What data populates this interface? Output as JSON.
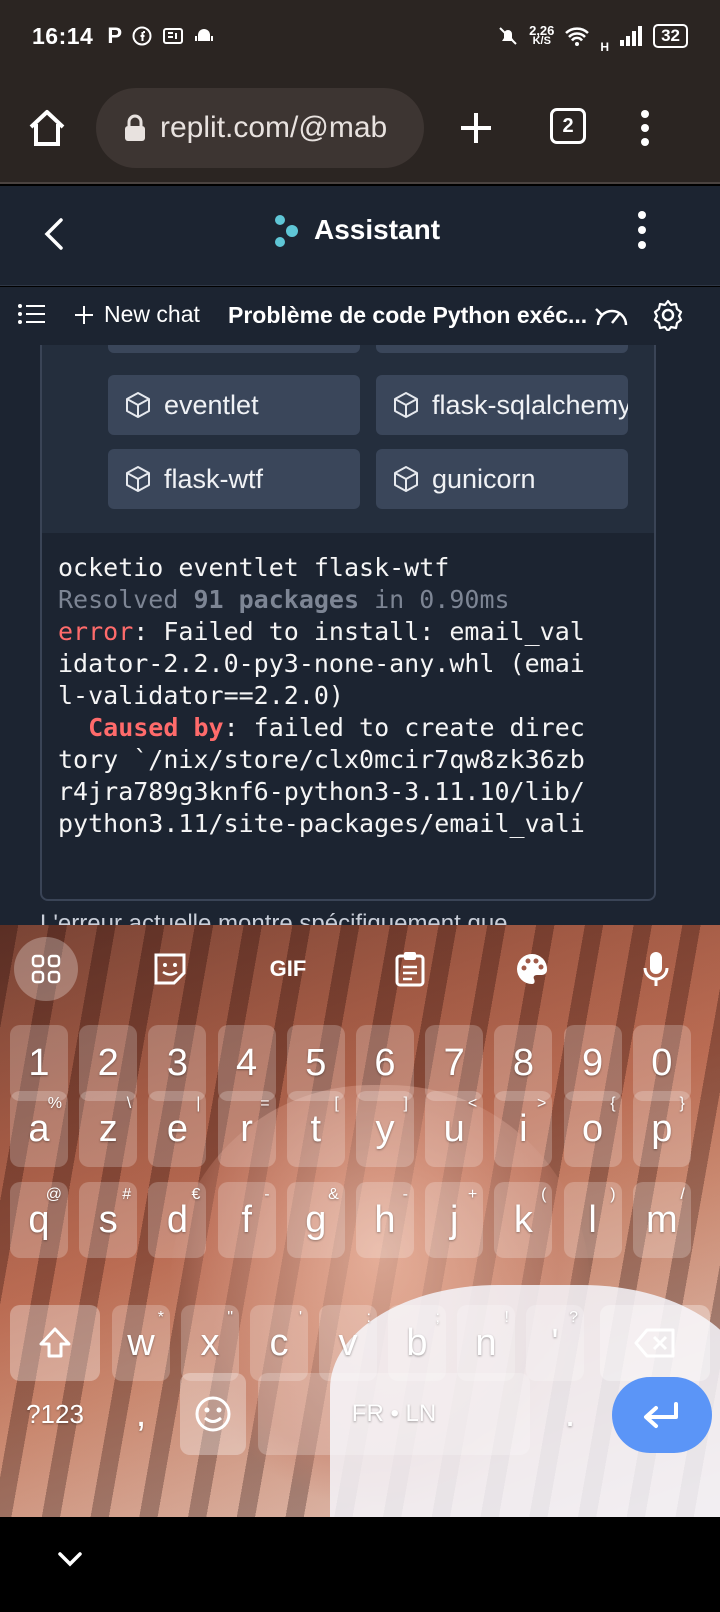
{
  "status_bar": {
    "time": "16:14",
    "net_speed_value": "2,26",
    "net_speed_unit": "K/S",
    "signal_label": "H",
    "battery": "32"
  },
  "browser": {
    "url": "replit.com/@mab",
    "tab_count": "2"
  },
  "app_header": {
    "title": "Assistant"
  },
  "toolbar": {
    "new_chat_label": "New chat",
    "chat_title": "Problème de code Python exéc..."
  },
  "packages": [
    "eventlet",
    "flask-sqlalchemy",
    "flask-wtf",
    "gunicorn"
  ],
  "terminal": {
    "line1": "ocketio eventlet flask-wtf",
    "resolved_prefix": "Resolved ",
    "resolved_count": "91 packages",
    "resolved_suffix": " in 0.90ms",
    "error_label": "error",
    "error_msg_1": ": Failed to install: email_val",
    "error_msg_2": "idator-2.2.0-py3-none-any.whl (emai",
    "error_msg_3": "l-validator==2.2.0)",
    "caused_by_label": "  Caused by",
    "caused_msg_1": ": failed to create direc",
    "caused_msg_2": "tory `/nix/store/clx0mcir7qw8zk36zb",
    "caused_msg_3": "r4jra789g3knf6-python3-3.11.10/lib/",
    "caused_msg_4": "python3.11/site-packages/email_vali"
  },
  "peek_text": "L'erreur actuelle montre spécifiquement que",
  "keyboard": {
    "toolbar_gif": "GIF",
    "number_row": [
      "1",
      "2",
      "3",
      "4",
      "5",
      "6",
      "7",
      "8",
      "9",
      "0"
    ],
    "row1": [
      {
        "k": "a",
        "s": "%"
      },
      {
        "k": "z",
        "s": "\\"
      },
      {
        "k": "e",
        "s": "|"
      },
      {
        "k": "r",
        "s": "="
      },
      {
        "k": "t",
        "s": "["
      },
      {
        "k": "y",
        "s": "]"
      },
      {
        "k": "u",
        "s": "<"
      },
      {
        "k": "i",
        "s": ">"
      },
      {
        "k": "o",
        "s": "{"
      },
      {
        "k": "p",
        "s": "}"
      }
    ],
    "row2": [
      {
        "k": "q",
        "s": "@"
      },
      {
        "k": "s",
        "s": "#"
      },
      {
        "k": "d",
        "s": "€"
      },
      {
        "k": "f",
        "s": "-"
      },
      {
        "k": "g",
        "s": "&"
      },
      {
        "k": "h",
        "s": "-"
      },
      {
        "k": "j",
        "s": "+"
      },
      {
        "k": "k",
        "s": "("
      },
      {
        "k": "l",
        "s": ")"
      },
      {
        "k": "m",
        "s": "/"
      }
    ],
    "row3": [
      {
        "k": "w",
        "s": "*"
      },
      {
        "k": "x",
        "s": "\""
      },
      {
        "k": "c",
        "s": "'"
      },
      {
        "k": "v",
        "s": ":"
      },
      {
        "k": "b",
        "s": ";"
      },
      {
        "k": "n",
        "s": "!"
      },
      {
        "k": "'",
        "s": "?"
      }
    ],
    "symbols_key": "?123",
    "comma_key": ",",
    "space_label": "FR • LN",
    "period_key": "."
  },
  "colors": {
    "accent_blue": "#5b95f7",
    "error_red": "#ff6b6b",
    "app_bg": "#1c2431"
  }
}
